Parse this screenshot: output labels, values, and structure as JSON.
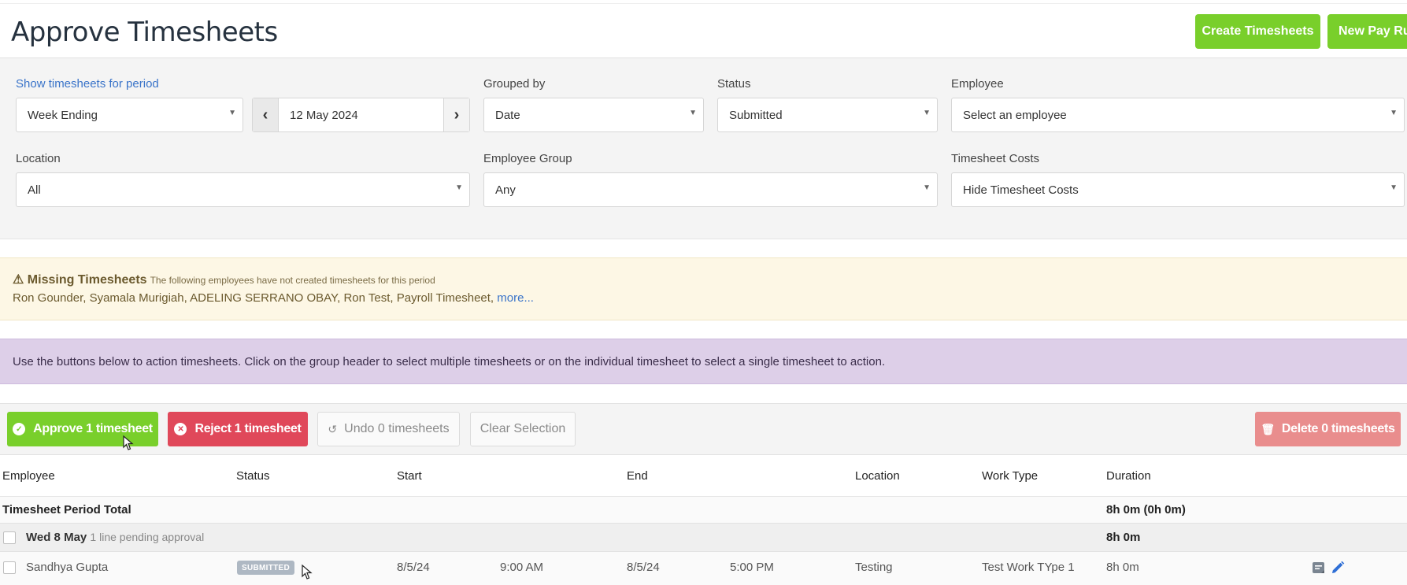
{
  "header": {
    "title": "Approve Timesheets",
    "create_btn": "Create Timesheets",
    "new_pay_run_btn": "New Pay Run"
  },
  "filters": {
    "period_label": "Show timesheets for period",
    "period_value": "Week Ending",
    "date_value": "12 May 2024",
    "grouped_label": "Grouped by",
    "grouped_value": "Date",
    "status_label": "Status",
    "status_value": "Submitted",
    "employee_label": "Employee",
    "employee_placeholder": "Select an employee",
    "location_label": "Location",
    "location_value": "All",
    "group_label": "Employee Group",
    "group_value": "Any",
    "costs_label": "Timesheet Costs",
    "costs_value": "Hide Timesheet Costs"
  },
  "missing": {
    "title": "Missing Timesheets",
    "subtitle": "The following employees have not created timesheets for this period",
    "names": "Ron Gounder, Syamala Murigiah, ADELING SERRANO OBAY, Ron Test, Payroll Timesheet,",
    "more": "more..."
  },
  "info": {
    "text": "Use the buttons below to action timesheets. Click on the group header to select multiple timesheets or on the individual timesheet to select a single timesheet to action."
  },
  "actions": {
    "approve": "Approve 1 timesheet",
    "reject": "Reject 1 timesheet",
    "undo": "Undo 0 timesheets",
    "clear": "Clear Selection",
    "delete": "Delete 0 timesheets"
  },
  "table": {
    "headers": {
      "employee": "Employee",
      "status": "Status",
      "start": "Start",
      "end": "End",
      "location": "Location",
      "work_type": "Work Type",
      "duration": "Duration"
    },
    "total": {
      "label": "Timesheet Period Total",
      "duration": "8h 0m (0h 0m)"
    },
    "group": {
      "date": "Wed 8 May",
      "note": "1 line pending approval",
      "duration": "8h 0m"
    },
    "rows": [
      {
        "employee": "Sandhya Gupta",
        "status": "SUBMITTED",
        "start_date": "8/5/24",
        "start_time": "9:00 AM",
        "end_date": "8/5/24",
        "end_time": "5:00 PM",
        "location": "Testing",
        "work_type": "Test Work TYpe 1",
        "duration": "8h 0m"
      }
    ]
  },
  "colors": {
    "green": "#79cf2b",
    "red": "#e0485a",
    "delete_red": "#e98d8d",
    "info_bg": "#ddcfe8",
    "warning_bg": "#fdf7e5",
    "link_blue": "#3a74c9"
  }
}
